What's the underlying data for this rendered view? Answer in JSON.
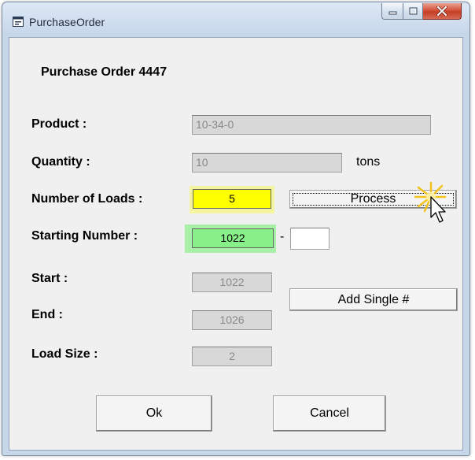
{
  "window": {
    "title": "PurchaseOrder"
  },
  "form": {
    "heading": "Purchase Order 4447",
    "product": {
      "label": "Product :",
      "value": "10-34-0"
    },
    "quantity": {
      "label": "Quantity :",
      "value": "10",
      "unit": "tons"
    },
    "loads": {
      "label": "Number of Loads :",
      "value": "5"
    },
    "starting": {
      "label": "Starting Number :",
      "value": "1022",
      "separator": "-",
      "suffix_value": ""
    },
    "start": {
      "label": "Start :",
      "value": "1022"
    },
    "end": {
      "label": "End :",
      "value": "1026"
    },
    "load_size": {
      "label": "Load Size :",
      "value": "2"
    }
  },
  "buttons": {
    "process": "Process",
    "add_single": "Add Single #",
    "ok": "Ok",
    "cancel": "Cancel"
  },
  "highlight_colors": {
    "loads": "#ffff00",
    "starting": "#88f088"
  },
  "icons": [
    "window-app-icon",
    "minimize-icon",
    "maximize-icon",
    "close-icon",
    "mouse-cursor-icon"
  ]
}
